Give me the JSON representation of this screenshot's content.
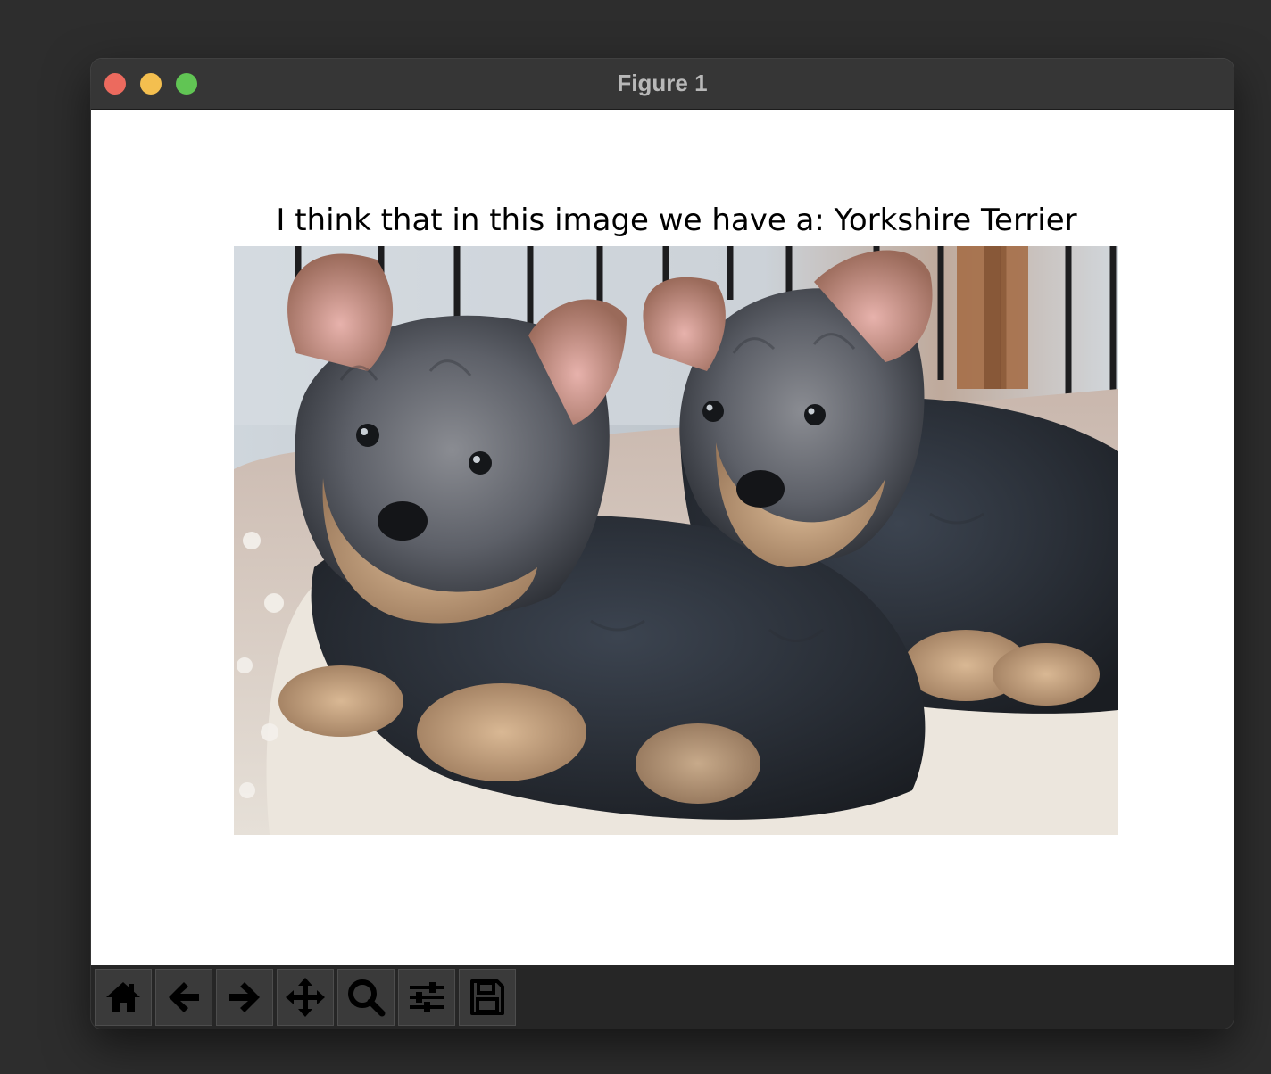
{
  "window": {
    "title": "Figure 1",
    "traffic_lights": {
      "close": "#ec6a5e",
      "minimize": "#f4bf4f",
      "zoom": "#61c554"
    }
  },
  "figure": {
    "title": "I think that in this image we have a: Yorkshire Terrier",
    "image": "photo of two Yorkshire Terrier puppies lying on a beige dog bed"
  },
  "toolbar": {
    "buttons": [
      {
        "name": "home",
        "icon": "home-icon"
      },
      {
        "name": "back",
        "icon": "arrow-left-icon"
      },
      {
        "name": "forward",
        "icon": "arrow-right-icon"
      },
      {
        "name": "pan",
        "icon": "move-icon"
      },
      {
        "name": "zoom",
        "icon": "magnifier-icon"
      },
      {
        "name": "configure-subplots",
        "icon": "sliders-icon"
      },
      {
        "name": "save",
        "icon": "floppy-disk-icon"
      }
    ]
  }
}
